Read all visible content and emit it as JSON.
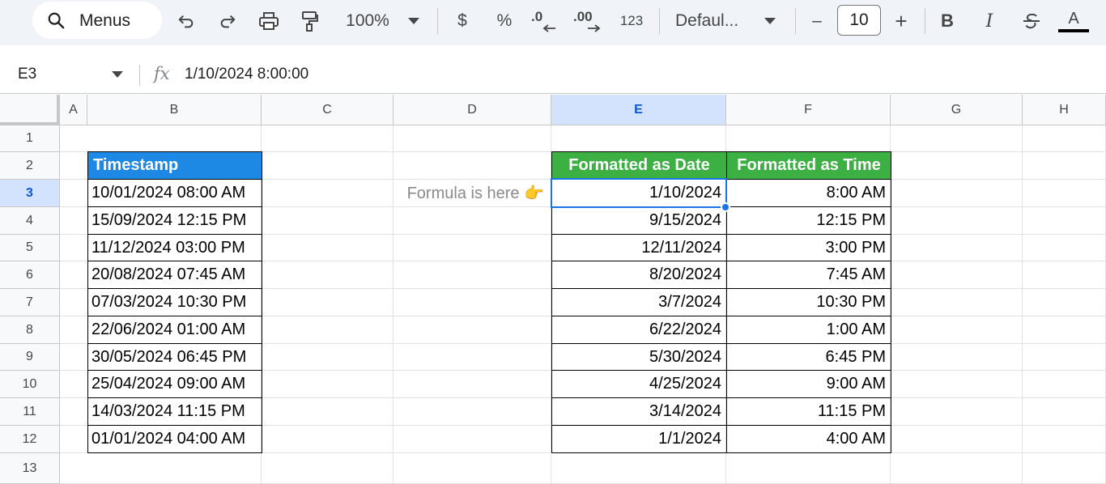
{
  "toolbar": {
    "menus_label": "Menus",
    "zoom": "100%",
    "currency": "$",
    "percent": "%",
    "dec_decrease": ".0",
    "dec_increase": ".00",
    "number_format": "123",
    "font_name": "Defaul...",
    "minus": "–",
    "font_size": "10",
    "plus": "+",
    "bold": "B",
    "italic": "I",
    "text_color_letter": "A"
  },
  "formula_bar": {
    "name_box": "E3",
    "fx": "fx",
    "content": "1/10/2024 8:00:00"
  },
  "columns": [
    "A",
    "B",
    "C",
    "D",
    "E",
    "F",
    "G",
    "H"
  ],
  "rows": [
    "1",
    "2",
    "3",
    "4",
    "5",
    "6",
    "7",
    "8",
    "9",
    "10",
    "11",
    "12",
    "13"
  ],
  "selected_cell": "E3",
  "headers": {
    "timestamp": "Timestamp",
    "date": "Formatted as Date",
    "time": "Formatted as Time"
  },
  "note": "Formula is here 👉",
  "table": [
    {
      "timestamp": "10/01/2024 08:00 AM",
      "date": "1/10/2024",
      "time": "8:00 AM"
    },
    {
      "timestamp": "15/09/2024 12:15 PM",
      "date": "9/15/2024",
      "time": "12:15 PM"
    },
    {
      "timestamp": "11/12/2024 03:00 PM",
      "date": "12/11/2024",
      "time": "3:00 PM"
    },
    {
      "timestamp": "20/08/2024 07:45 AM",
      "date": "8/20/2024",
      "time": "7:45 AM"
    },
    {
      "timestamp": "07/03/2024 10:30 PM",
      "date": "3/7/2024",
      "time": "10:30 PM"
    },
    {
      "timestamp": "22/06/2024 01:00 AM",
      "date": "6/22/2024",
      "time": "1:00 AM"
    },
    {
      "timestamp": "30/05/2024 06:45 PM",
      "date": "5/30/2024",
      "time": "6:45 PM"
    },
    {
      "timestamp": "25/04/2024 09:00 AM",
      "date": "4/25/2024",
      "time": "9:00 AM"
    },
    {
      "timestamp": "14/03/2024 11:15 PM",
      "date": "3/14/2024",
      "time": "11:15 PM"
    },
    {
      "timestamp": "01/01/2024 04:00 AM",
      "date": "1/1/2024",
      "time": "4:00 AM"
    }
  ],
  "colors": {
    "timestamp_header": "#1e88e5",
    "formatted_header": "#3cb043",
    "selection": "#1a73e8",
    "selected_header": "#d3e3fd"
  }
}
